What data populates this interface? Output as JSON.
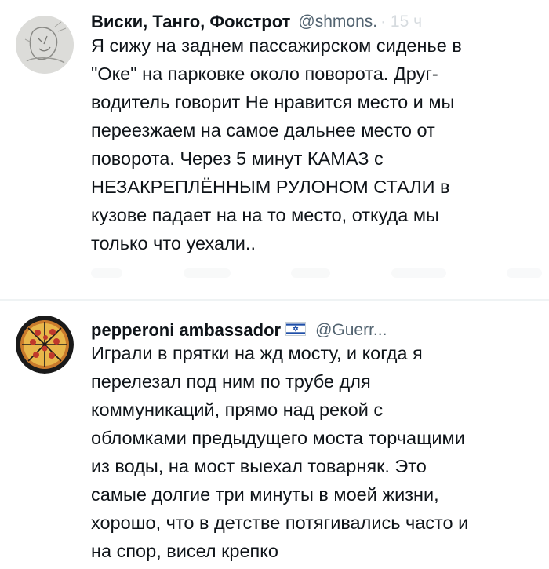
{
  "tweets": [
    {
      "display_name": "Виски, Танго, Фокстрот",
      "handle": "@shmons.",
      "time_faded": "· 15 ч",
      "text": "Я сижу на заднем пассажирском сиденье в\n\"Оке\" на парковке около поворота. Друг-\nводитель говорит Не нравится место и мы\nпереезжаем на самое дальнее место от\nповорота. Через 5 минут КАМАЗ с\nНЕЗАКРЕПЛЁННЫМ РУЛОНОМ СТАЛИ в\nкузове падает на на то место, откуда мы\nтолько что уехали..",
      "avatar_icon": "sketch-avatar-icon"
    },
    {
      "display_name": "pepperoni ambassador",
      "flag_icon": "israel-flag-icon",
      "handle": "@Guerr...",
      "text": "Играли в прятки на жд мосту, и когда я\nперелезал под ним по трубе для\nкоммуникаций, прямо над рекой с\nобломками предыдущего моста торчащими\nиз воды, на мост выехал товарняк. Это\nсамые долгие три минуты в моей жизни,\nхорошо, что в детстве потягивались часто и\nна спор, висел крепко",
      "avatar_icon": "pizza-avatar-icon"
    }
  ],
  "colors": {
    "text": "#0f1419",
    "secondary": "#536471",
    "divider": "#eff3f4"
  }
}
